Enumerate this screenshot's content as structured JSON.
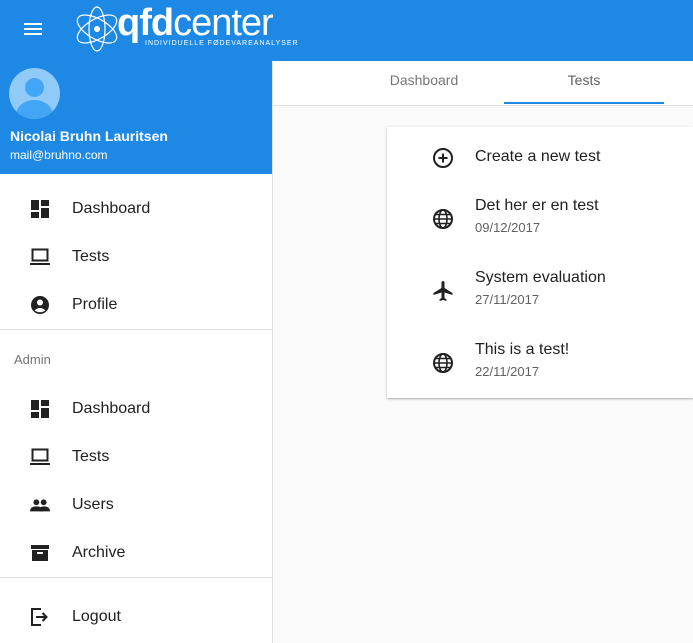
{
  "app": {
    "logo_text_bold": "qfd",
    "logo_text_thin": "center",
    "logo_subtitle": "INDIVIDUELLE FØDEVAREANALYSER"
  },
  "profile": {
    "name": "Nicolai Bruhn Lauritsen",
    "email": "mail@bruhno.com"
  },
  "nav": {
    "main": [
      {
        "label": "Dashboard",
        "icon": "dashboard-icon"
      },
      {
        "label": "Tests",
        "icon": "computer-icon"
      },
      {
        "label": "Profile",
        "icon": "account-circle-icon"
      }
    ],
    "admin_header": "Admin",
    "admin": [
      {
        "label": "Dashboard",
        "icon": "dashboard-icon"
      },
      {
        "label": "Tests",
        "icon": "computer-icon"
      },
      {
        "label": "Users",
        "icon": "people-icon"
      },
      {
        "label": "Archive",
        "icon": "archive-icon"
      }
    ],
    "logout": "Logout"
  },
  "tabs": [
    {
      "label": "Dashboard"
    },
    {
      "label": "Tests",
      "active": true
    }
  ],
  "tests": {
    "create_label": "Create a new test",
    "items": [
      {
        "title": "Det her er en test",
        "date": "09/12/2017",
        "icon": "globe-icon"
      },
      {
        "title": "System evaluation",
        "date": "27/11/2017",
        "icon": "airplane-icon"
      },
      {
        "title": "This is a test!",
        "date": "22/11/2017",
        "icon": "globe-icon"
      }
    ]
  },
  "colors": {
    "primary": "#1e88e5",
    "icon": "#212121"
  }
}
